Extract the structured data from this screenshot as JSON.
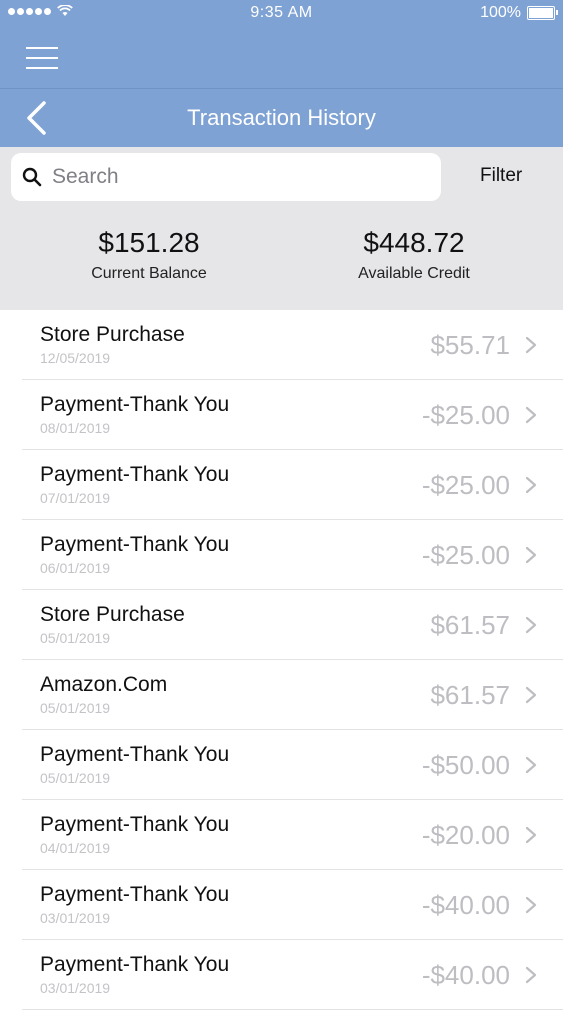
{
  "status_bar": {
    "time": "9:35 AM",
    "battery_percent": "100%"
  },
  "nav": {
    "title": "Transaction History"
  },
  "search": {
    "placeholder": "Search",
    "filter_label": "Filter"
  },
  "summary": {
    "current_balance": "$151.28",
    "current_balance_label": "Current Balance",
    "available_credit": "$448.72",
    "available_credit_label": "Available Credit"
  },
  "transactions": [
    {
      "name": "Store Purchase",
      "date": "12/05/2019",
      "amount": "$55.71"
    },
    {
      "name": "Payment-Thank You",
      "date": "08/01/2019",
      "amount": "-$25.00"
    },
    {
      "name": "Payment-Thank You",
      "date": "07/01/2019",
      "amount": "-$25.00"
    },
    {
      "name": "Payment-Thank You",
      "date": "06/01/2019",
      "amount": "-$25.00"
    },
    {
      "name": "Store Purchase",
      "date": "05/01/2019",
      "amount": "$61.57"
    },
    {
      "name": "Amazon.Com",
      "date": "05/01/2019",
      "amount": "$61.57"
    },
    {
      "name": "Payment-Thank You",
      "date": "05/01/2019",
      "amount": "-$50.00"
    },
    {
      "name": "Payment-Thank You",
      "date": "04/01/2019",
      "amount": "-$20.00"
    },
    {
      "name": "Payment-Thank You",
      "date": "03/01/2019",
      "amount": "-$40.00"
    },
    {
      "name": "Payment-Thank You",
      "date": "03/01/2019",
      "amount": "-$40.00"
    }
  ],
  "colors": {
    "header_bg": "#7fa2d4",
    "summary_bg": "#e6e5e8",
    "amount_text": "#bdbdc2",
    "date_text": "#c3c3c8"
  },
  "icons": {
    "menu": "hamburger-icon",
    "back": "chevron-left-icon",
    "search": "search-icon",
    "row_disclosure": "chevron-right-icon"
  }
}
